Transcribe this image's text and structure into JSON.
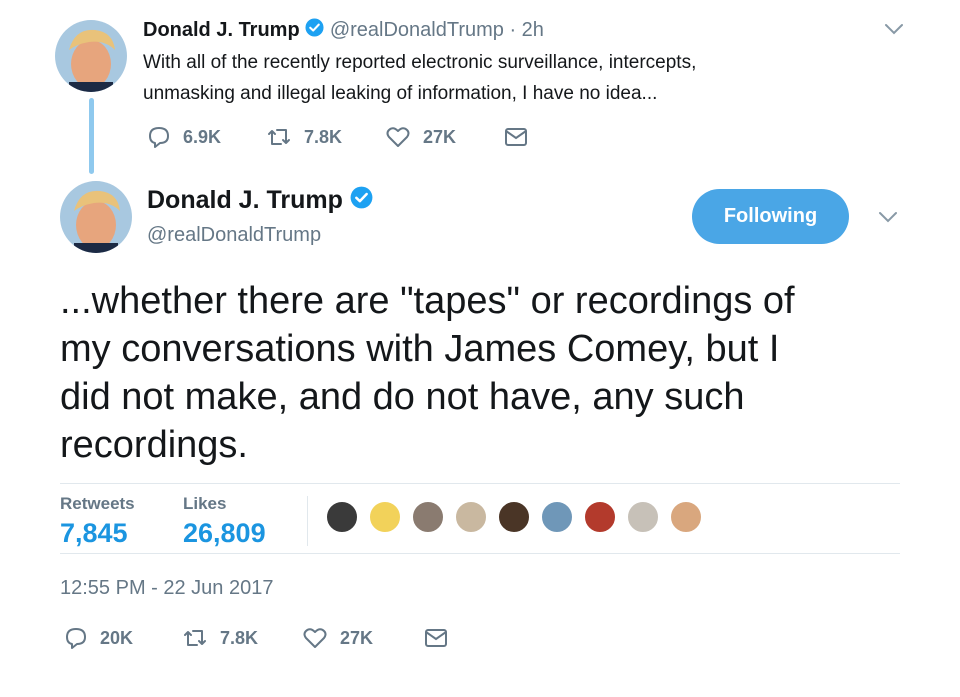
{
  "tweet1": {
    "name": "Donald J. Trump",
    "handle": "@realDonaldTrump",
    "time": "· 2h",
    "text_line1": "With all of the recently reported electronic surveillance, intercepts,",
    "text_line2": "unmasking and illegal leaking of information, I have no idea...",
    "replies": "6.9K",
    "retweets": "7.8K",
    "likes": "27K"
  },
  "tweet2": {
    "name": "Donald J. Trump",
    "handle": "@realDonaldTrump",
    "follow_label": "Following",
    "text_line1": "...whether there are \"tapes\" or recordings of",
    "text_line2": "my conversations with James Comey, but I",
    "text_line3": "did not make, and do not have, any such",
    "text_line4": "recordings.",
    "retweets_label": "Retweets",
    "retweets_value": "7,845",
    "likes_label": "Likes",
    "likes_value": "26,809",
    "timestamp": "12:55 PM - 22 Jun 2017",
    "replies": "20K",
    "retweet_count": "7.8K",
    "like_count": "27K"
  },
  "likers": [
    {
      "color": "#3a3a3a"
    },
    {
      "color": "#f2d25a"
    },
    {
      "color": "#8a7b70"
    },
    {
      "color": "#c9b8a0"
    },
    {
      "color": "#4a3526"
    },
    {
      "color": "#6f97b8"
    },
    {
      "color": "#b33a2c"
    },
    {
      "color": "#c7c1b8"
    },
    {
      "color": "#d9a77e"
    }
  ],
  "colors": {
    "accent": "#1b95e0",
    "follow_button": "#4aa6e6",
    "secondary_text": "#657786",
    "thread_line": "#8fc9ee"
  }
}
